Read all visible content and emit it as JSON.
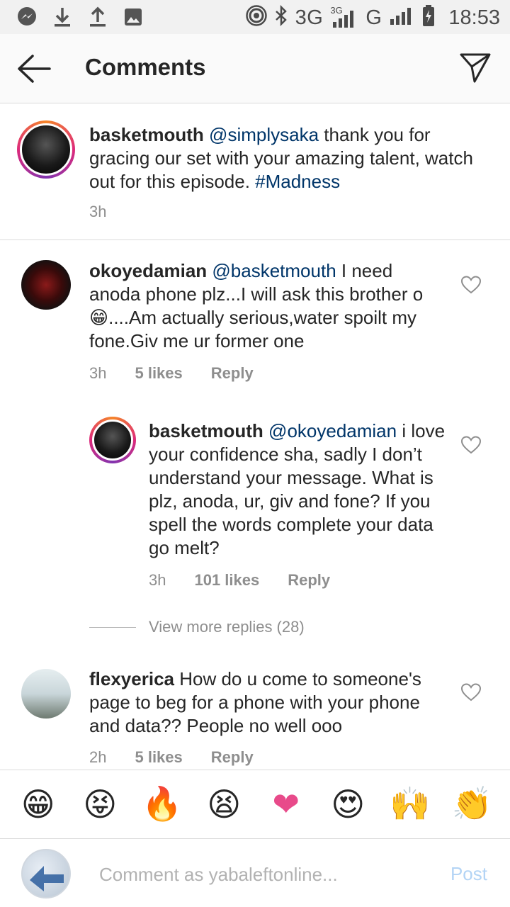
{
  "status_bar": {
    "network_text": "3G",
    "network_sub": "3G",
    "network_text2": "G",
    "time": "18:53",
    "icons": [
      "messenger-icon",
      "download-icon",
      "upload-icon",
      "image-icon",
      "hotspot-icon",
      "bluetooth-icon",
      "signal-icon",
      "battery-icon"
    ]
  },
  "header": {
    "title": "Comments",
    "back_icon": "arrow-left-icon",
    "send_icon": "paper-plane-icon"
  },
  "comments": [
    {
      "user": "basketmouth",
      "mention": "@simplysaka",
      "text_before": " thank you for gracing our set with your amazing talent, watch out for this episode. ",
      "hashtag": "#Madness",
      "time": "3h"
    },
    {
      "user": "okoyedamian",
      "mention": "@basketmouth",
      "text": " I need anoda phone plz...I will ask this brother o",
      "emoji": "😁",
      "text_after": "....Am actually serious,water spoilt my fone.Giv me ur former one",
      "time": "3h",
      "likes": "5 likes",
      "reply": "Reply"
    },
    {
      "user": "basketmouth",
      "mention": "@okoyedamian",
      "text": " i love your confidence sha, sadly I don’t understand your message. What is plz, anoda, ur, giv and fone? If you spell the words complete your data go melt?",
      "time": "3h",
      "likes": "101 likes",
      "reply": "Reply"
    },
    {
      "user": "flexyerica",
      "text": " How do u come to someone's page to beg for a phone with your phone and data?? People no well ooo",
      "time": "2h",
      "likes": "5 likes",
      "reply": "Reply"
    }
  ],
  "view_more_replies": "View more replies (28)",
  "emoji_bar": [
    "😁",
    "😝",
    "🔥",
    "😫",
    "❤",
    "😍",
    "🙌",
    "👏"
  ],
  "comment_input": {
    "placeholder": "Comment as yabaleftonline...",
    "post_label": "Post"
  }
}
